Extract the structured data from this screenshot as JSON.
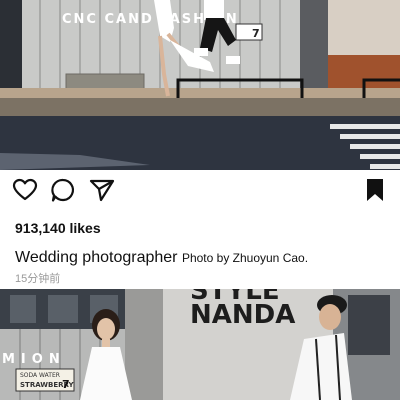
{
  "post": {
    "likes_text": "913,140 likes",
    "caption_main": "Wedding photographer",
    "caption_credit": "Photo by Zhuoyun Cao.",
    "time_ago": "15分钟前"
  },
  "photo_top": {
    "sign_text": "CNC CAND FASHION",
    "parking_number": "7"
  },
  "photo_bottom": {
    "sign_line1": "STYLE",
    "sign_line2": "NANDA",
    "side_text": "MION",
    "plate_line1": "SODA WATER",
    "plate_line2": "STRAWBERRY",
    "plate_number": "7"
  },
  "icons": {
    "like": "heart-icon",
    "comment": "comment-icon",
    "share": "send-icon",
    "save": "bookmark-icon"
  }
}
